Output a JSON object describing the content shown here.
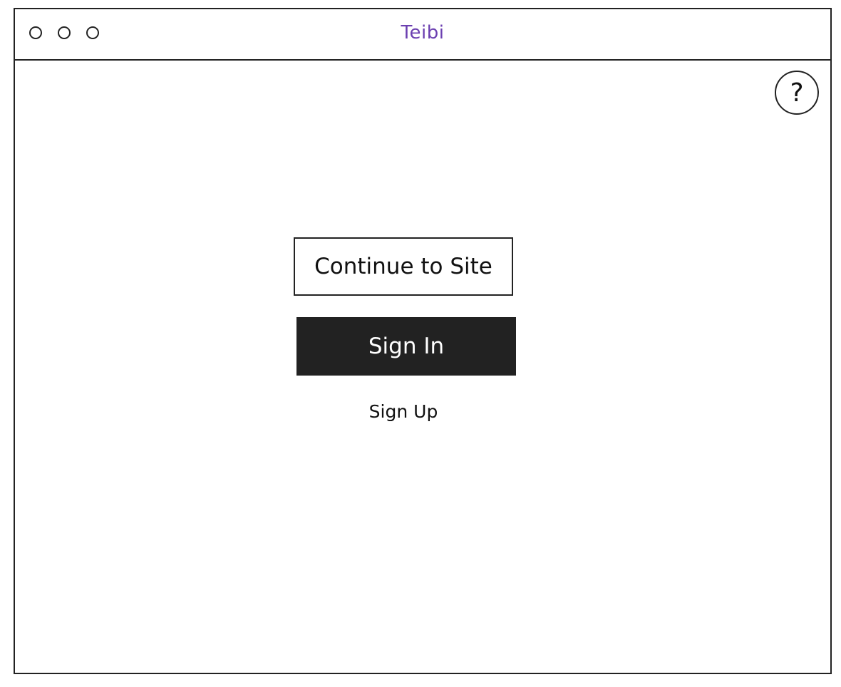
{
  "window": {
    "title": "Teibi"
  },
  "help": {
    "label": "?"
  },
  "main": {
    "continue_label": "Continue to Site",
    "signin_label": "Sign In",
    "signup_label": "Sign Up"
  },
  "colors": {
    "title": "#6b3fb0",
    "signin_bg": "#222222",
    "border": "#222222"
  }
}
